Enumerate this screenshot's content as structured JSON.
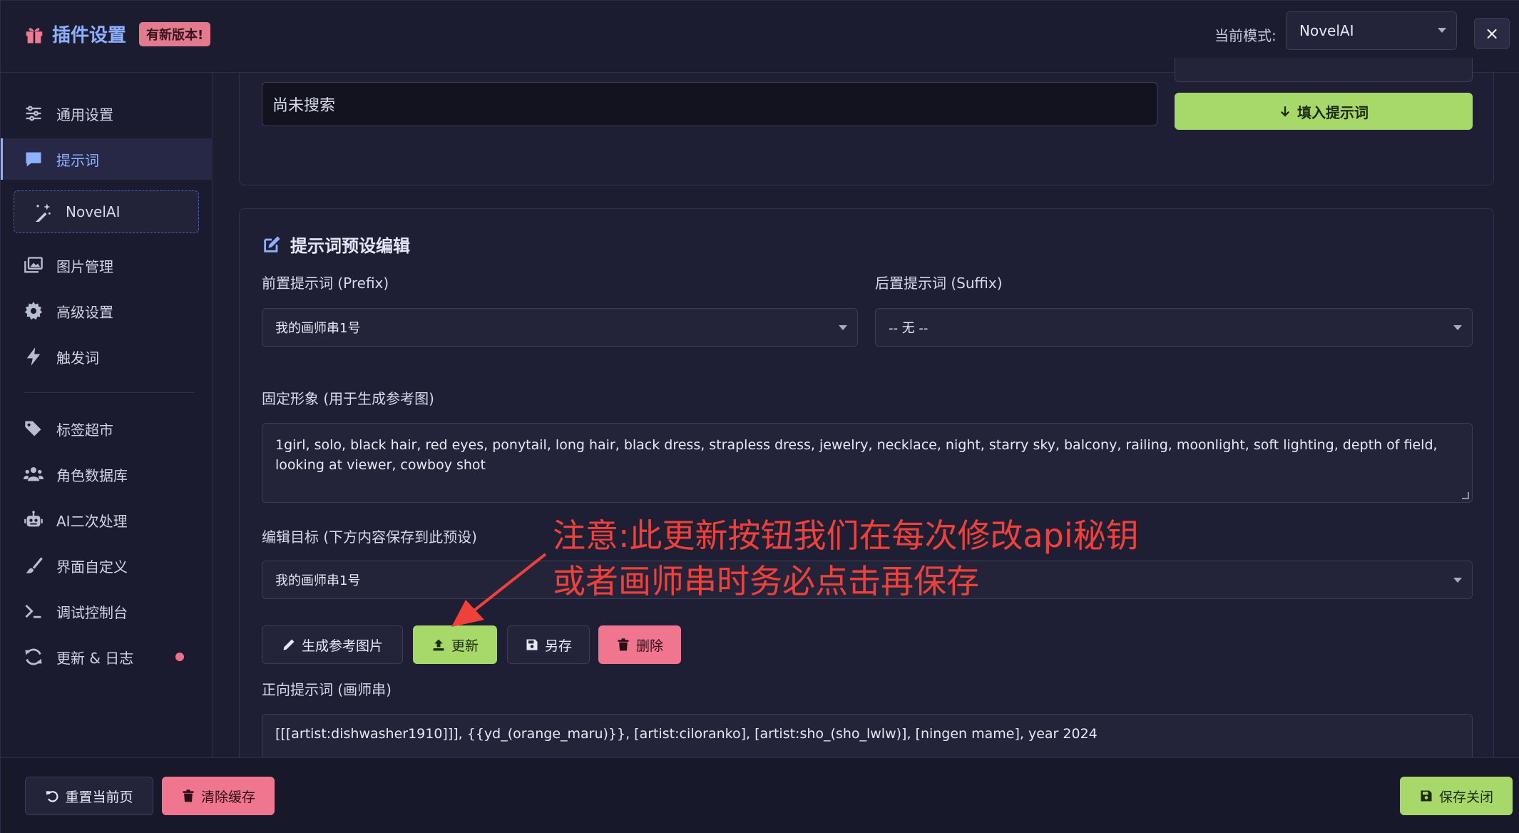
{
  "header": {
    "title": "插件设置",
    "badge": "有新版本!",
    "mode_label": "当前模式:",
    "mode_value": "NovelAI",
    "close_label": "×"
  },
  "sidebar": {
    "items": [
      {
        "label": "通用设置",
        "icon": "sliders-icon"
      },
      {
        "label": "提示词",
        "icon": "comment-icon"
      },
      {
        "label": "NovelAI",
        "icon": "magic-wand-icon"
      },
      {
        "label": "图片管理",
        "icon": "images-icon"
      },
      {
        "label": "高级设置",
        "icon": "gear-icon"
      },
      {
        "label": "触发词",
        "icon": "bolt-icon"
      },
      {
        "label": "标签超市",
        "icon": "tags-icon"
      },
      {
        "label": "角色数据库",
        "icon": "users-icon"
      },
      {
        "label": "AI二次处理",
        "icon": "robot-icon"
      },
      {
        "label": "界面自定义",
        "icon": "brush-icon"
      },
      {
        "label": "调试控制台",
        "icon": "terminal-icon"
      },
      {
        "label": "更新 & 日志",
        "icon": "sync-icon"
      }
    ],
    "active": "提示词"
  },
  "search": {
    "status": "尚未搜索",
    "fill_button": "填入提示词"
  },
  "editor": {
    "title": "提示词预设编辑",
    "prefix_label": "前置提示词 (Prefix)",
    "prefix_value": "我的画师串1号",
    "suffix_label": "后置提示词 (Suffix)",
    "suffix_value": "-- 无 --",
    "fixed_label": "固定形象 (用于生成参考图)",
    "fixed_value": "1girl, solo, black hair, red eyes, ponytail, long hair, black dress, strapless dress, jewelry, necklace, night, starry sky, balcony, railing, moonlight, soft lighting, depth of field, looking at viewer, cowboy shot",
    "target_label": "编辑目标 (下方内容保存到此预设)",
    "target_value": "我的画师串1号",
    "buttons": {
      "generate": "生成参考图片",
      "update": "更新",
      "save_as": "另存",
      "delete": "删除"
    },
    "positive_label": "正向提示词 (画师串)",
    "positive_value": "[[[artist:dishwasher1910]]], {{yd_(orange_maru)}}, [artist:ciloranko], [artist:sho_(sho_lwlw)], [ningen mame], year 2024"
  },
  "annotation": {
    "line1": "注意:此更新按钮我们在每次修改api秘钥",
    "line2": "或者画师串时务必点击再保存",
    "color": "#f0403a"
  },
  "footer": {
    "reset": "重置当前页",
    "clear_cache": "清除缓存",
    "save_close": "保存关闭"
  },
  "colors": {
    "accent": "#8fb0ff",
    "green": "#a7d86a",
    "red": "#f0768f"
  }
}
